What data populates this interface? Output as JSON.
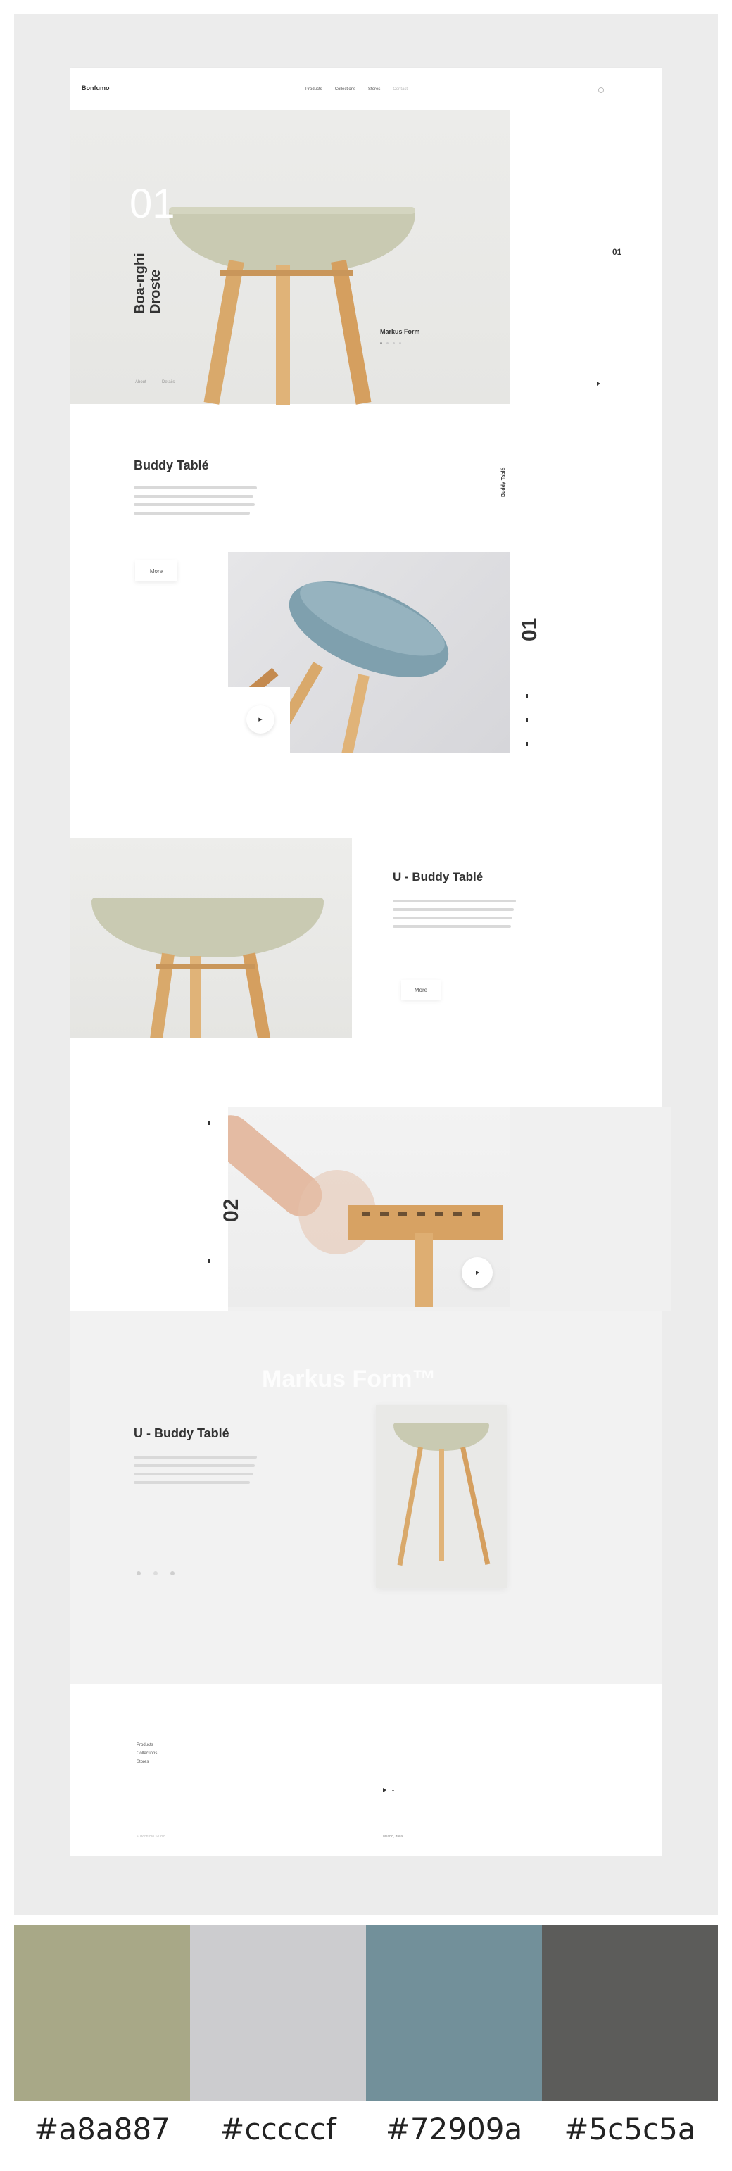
{
  "header": {
    "logo": "Bonfumo",
    "nav": [
      "Products",
      "Collections",
      "Stores",
      "Contact"
    ]
  },
  "hero": {
    "number": "01",
    "title_line1": "Boa-nghi",
    "title_line2": "Droste",
    "designer": "Markus Form",
    "side_number": "01",
    "caption_left": "About",
    "caption_right": "Details"
  },
  "section1": {
    "title": "Buddy Tablé",
    "vertical_label": "Buddy Tablé",
    "button": "More",
    "side_number": "01",
    "arrow": "▶"
  },
  "section2": {
    "title": "U - Buddy Tablé",
    "button": "More"
  },
  "section3": {
    "number": "02"
  },
  "section4": {
    "watermark": "Markus Form™",
    "title": "U - Buddy Tablé"
  },
  "footer": {
    "links": [
      "Products",
      "Collections",
      "Stores"
    ],
    "copyright": "© Bonfumo Studio",
    "address": "Milano, Italia"
  },
  "palette": [
    {
      "hex": "#a8a887",
      "label": "#a8a887"
    },
    {
      "hex": "#cccccf",
      "label": "#cccccf"
    },
    {
      "hex": "#72909a",
      "label": "#72909a"
    },
    {
      "hex": "#5c5c5a",
      "label": "#5c5c5a"
    }
  ]
}
